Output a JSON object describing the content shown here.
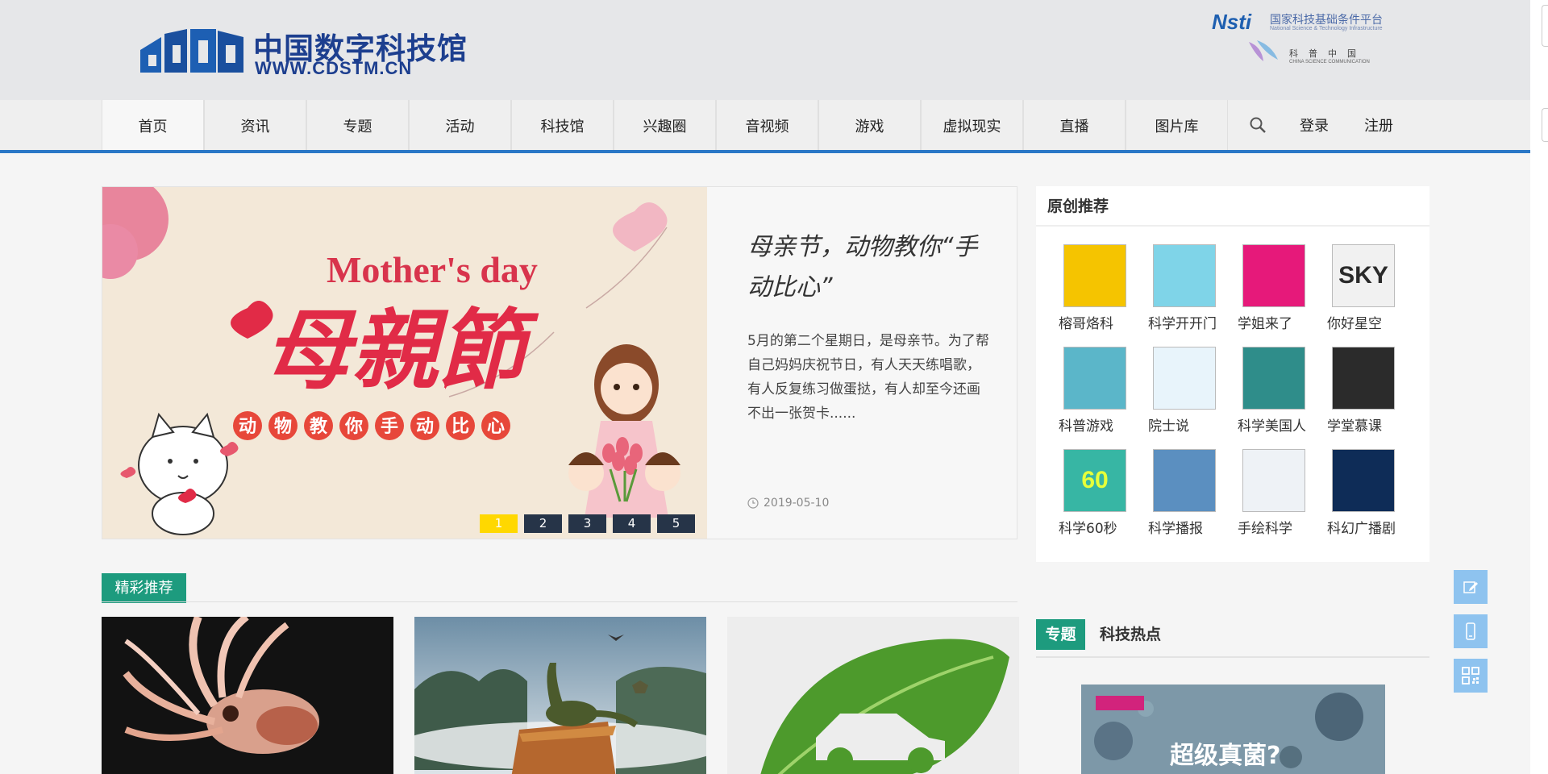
{
  "site": {
    "logo_cn": "中国数字科技馆",
    "logo_en": "WWW.CDSTM.CN",
    "partner1_mark": "Nsti",
    "partner1_cn": "国家科技基础条件平台",
    "partner1_en": "National Science & Technology Infrastructure",
    "partner2_cn": "科普中国",
    "partner2_en": "CHINA SCIENCE COMMUNICATION"
  },
  "nav": {
    "items": [
      {
        "label": "首页",
        "color": "#e8245c"
      },
      {
        "label": "资讯",
        "color": "#f7b60f"
      },
      {
        "label": "专题",
        "color": "#1d9b5e"
      },
      {
        "label": "活动",
        "color": "#2a77c6"
      },
      {
        "label": "科技馆",
        "color": "#77b414"
      },
      {
        "label": "兴趣圈",
        "color": "#ee5d8e"
      },
      {
        "label": "音视频",
        "color": "#f3d516"
      },
      {
        "label": "游戏",
        "color": "#f7941d"
      },
      {
        "label": "虚拟现实",
        "color": "#f3d516"
      },
      {
        "label": "直播",
        "color": "#f7b60f"
      },
      {
        "label": "图片库",
        "color": "#2a77c6"
      }
    ],
    "login": "登录",
    "register": "注册"
  },
  "slider": {
    "title": "母亲节，动物教你“手动比心”",
    "desc": "5月的第二个星期日，是母亲节。为了帮自己妈妈庆祝节日，有人天天练唱歌，有人反复练习做蛋挞，有人却至今还画不出一张贺卡......",
    "date": "2019-05-10",
    "image_text_en": "Mother's day",
    "image_text_cn": "母親節",
    "image_text_sub": [
      "动",
      "物",
      "教",
      "你",
      "手",
      "动",
      "比",
      "心"
    ],
    "pages": [
      "1",
      "2",
      "3",
      "4",
      "5"
    ],
    "active_page": 0
  },
  "originals": {
    "title": "原创推荐",
    "items": [
      {
        "label": "榕哥烙科",
        "bg": "#f5c400"
      },
      {
        "label": "科学开开门",
        "bg": "#7fd4e8"
      },
      {
        "label": "学姐来了",
        "bg": "#e6197a"
      },
      {
        "label": "你好星空",
        "bg": "#f1f1f1",
        "text": "SKY"
      },
      {
        "label": "科普游戏",
        "bg": "#5bb6c9"
      },
      {
        "label": "院士说",
        "bg": "#e8f4fb"
      },
      {
        "label": "科学美国人",
        "bg": "#2f8d8a"
      },
      {
        "label": "学堂慕课",
        "bg": "#2b2b2b"
      },
      {
        "label": "科学60秒",
        "bg": "#37b6a4",
        "text": "60"
      },
      {
        "label": "科学播报",
        "bg": "#5b8fc0"
      },
      {
        "label": "手绘科学",
        "bg": "#eef2f6"
      },
      {
        "label": "科幻广播剧",
        "bg": "#0e2c57"
      }
    ]
  },
  "featured": {
    "tag": "精彩推荐"
  },
  "topics": {
    "tab_active": "专题",
    "tab_other": "科技热点",
    "image_text": "超级真菌?"
  }
}
